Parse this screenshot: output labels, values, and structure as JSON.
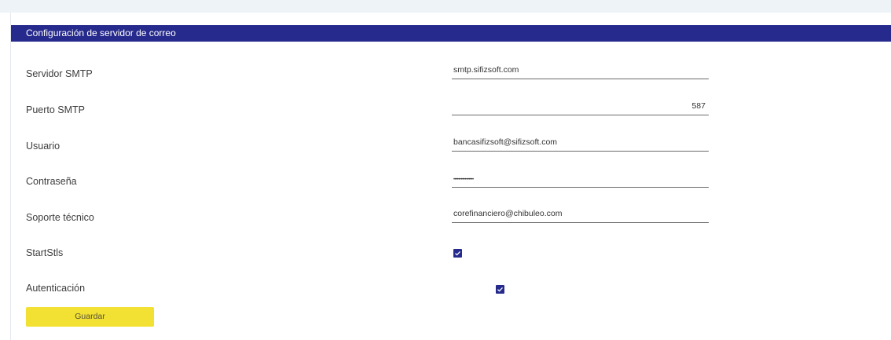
{
  "panel": {
    "title": "Configuración de servidor de correo"
  },
  "fields": {
    "smtp_server": {
      "label": "Servidor SMTP",
      "value": "smtp.sifizsoft.com"
    },
    "smtp_port": {
      "label": "Puerto SMTP",
      "value": "587"
    },
    "user": {
      "label": "Usuario",
      "value": "bancasifizsoft@sifizsoft.com"
    },
    "password": {
      "label": "Contraseña",
      "value": "••••••••••••••••"
    },
    "support": {
      "label": "Soporte técnico",
      "value": "corefinanciero@chibuleo.com"
    }
  },
  "checks": {
    "starttls": {
      "label": "StartStls",
      "checked": true
    },
    "auth": {
      "label": "Autenticación",
      "checked": true
    }
  },
  "actions": {
    "save_label": "Guardar"
  },
  "colors": {
    "header": "#262a8c",
    "checkbox": "#262a8c",
    "save_button": "#f2e132"
  }
}
